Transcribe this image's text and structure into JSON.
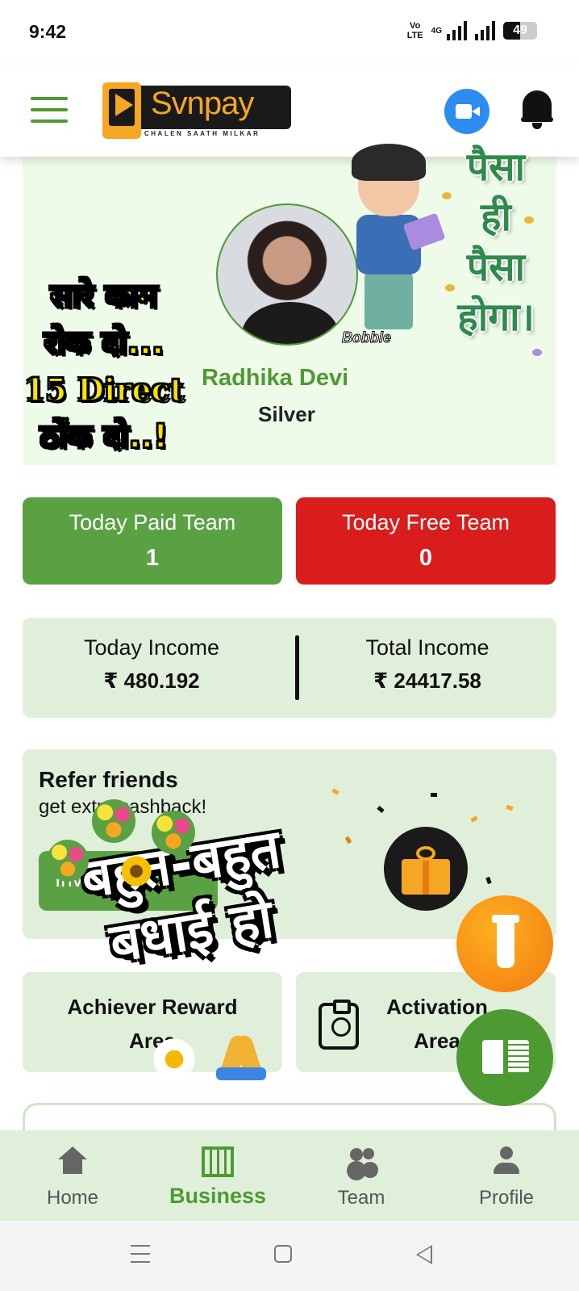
{
  "status_bar": {
    "time": "9:42",
    "volte_top": "Vo",
    "volte_bottom": "LTE",
    "network": "4G",
    "battery": "49",
    "battery_level": 0.49
  },
  "header": {
    "logo_text": "Svnpay",
    "logo_tagline": "CHALEN SAATH MILKAR",
    "icons": [
      "menu-icon",
      "video-call-icon",
      "bell-icon"
    ]
  },
  "profile": {
    "name": "Radhika Devi",
    "rank": "Silver",
    "sticker_left": [
      "सारे काम",
      "रोक दो...",
      "15 Direct",
      "ठोंक दो..!"
    ],
    "sticker_right": [
      "पैसा",
      "ही",
      "पैसा",
      "होगा।"
    ],
    "sticker_brand": "Bobble"
  },
  "team": {
    "paid_label": "Today Paid Team",
    "paid_value": "1",
    "free_label": "Today Free Team",
    "free_value": "0"
  },
  "income": {
    "today_label": "Today Income",
    "today_value": "₹ 480.192",
    "total_label": "Total Income",
    "total_value": "₹ 24417.58"
  },
  "refer": {
    "title": "Refer friends",
    "subtitle": "get extra cashback!",
    "button_label": "Invite friends"
  },
  "services": {
    "left_title": "Achiever Reward Area",
    "left_line1": "Achiever Reward",
    "left_line2": "Area",
    "right_line1": "Activation",
    "right_line2": "Area"
  },
  "overlay_sticker": {
    "line1": "बहुत-बहुत",
    "line2": "बधाई हो"
  },
  "bottom_nav": {
    "items": [
      {
        "label": "Home",
        "icon": "home-icon"
      },
      {
        "label": "Business",
        "icon": "business-icon",
        "active": true
      },
      {
        "label": "Team",
        "icon": "team-icon"
      },
      {
        "label": "Profile",
        "icon": "profile-icon"
      }
    ]
  },
  "colors": {
    "brand_green": "#4e9a32",
    "paid_green": "#5aa144",
    "free_red": "#d91c1c",
    "card_bg": "#e0efda",
    "logo_orange": "#f5a623",
    "zoom_blue": "#2d8cf0"
  }
}
